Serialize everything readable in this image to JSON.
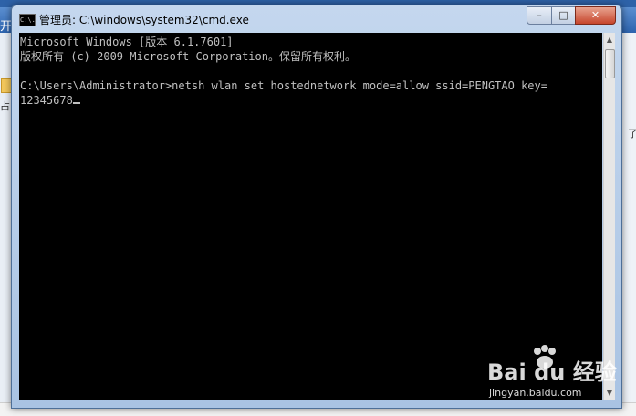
{
  "window": {
    "title": "管理员: C:\\windows\\system32\\cmd.exe",
    "icon_label": "C:\\."
  },
  "controls": {
    "minimize": "–",
    "maximize": "□",
    "close": "✕"
  },
  "console": {
    "lines": [
      "Microsoft Windows [版本 6.1.7601]",
      "版权所有 (c) 2009 Microsoft Corporation。保留所有权利。",
      "",
      "C:\\Users\\Administrator>netsh wlan set hostednetwork mode=allow ssid=PENGTAO key=",
      "12345678"
    ]
  },
  "background": {
    "left_text_1": "开",
    "left_text_2": "占",
    "right_mark": "了"
  },
  "watermark": {
    "logo": "Bai du 经验",
    "url": "jingyan.baidu.com"
  },
  "colors": {
    "console_bg": "#000000",
    "console_fg": "#c0c0c0",
    "close_button": "#c6452c"
  }
}
